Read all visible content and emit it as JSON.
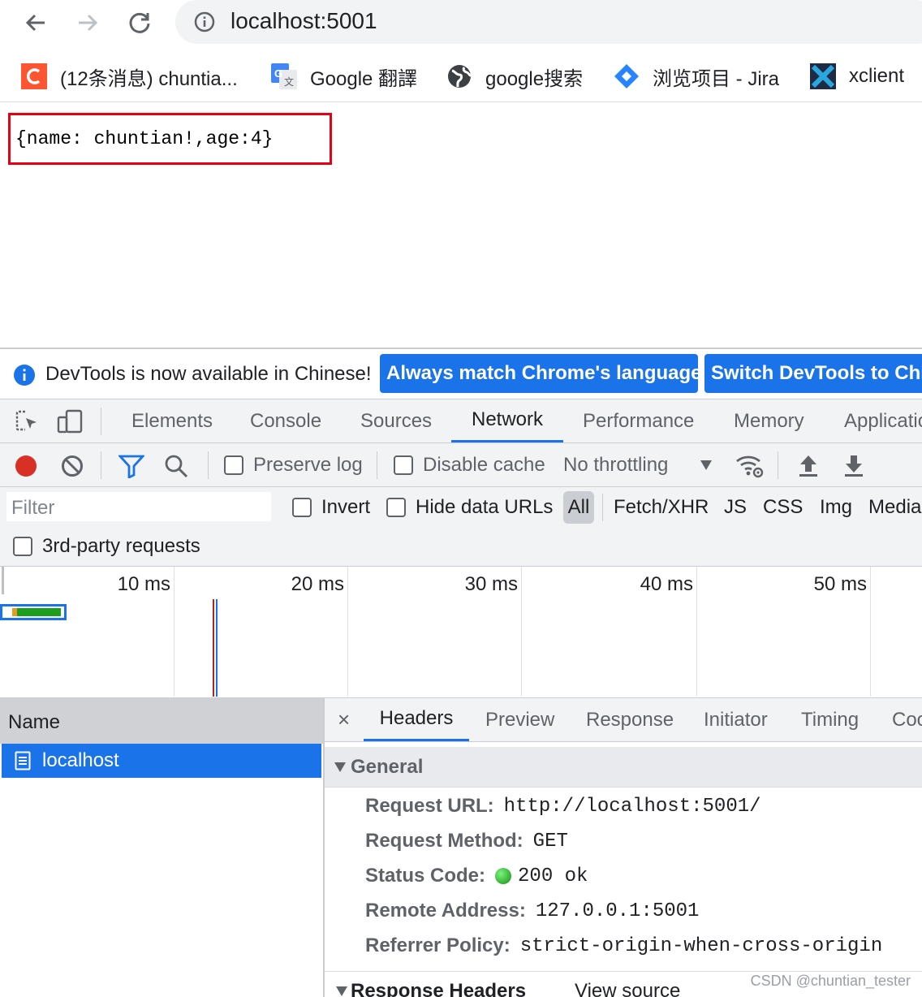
{
  "browser": {
    "url": "localhost:5001",
    "bookmarks": [
      {
        "label": "(12条消息) chuntia...",
        "icon": "csdn-icon"
      },
      {
        "label": "Google 翻譯",
        "icon": "google-translate-icon"
      },
      {
        "label": "google搜索",
        "icon": "globe-icon"
      },
      {
        "label": "浏览项目 - Jira",
        "icon": "jira-icon"
      },
      {
        "label": "xclient",
        "icon": "xclient-icon"
      }
    ]
  },
  "page": {
    "json_text": "{name: chuntian!,age:4}"
  },
  "devtools": {
    "infobar": {
      "message": "DevTools is now available in Chinese!",
      "btn_match": "Always match Chrome's language",
      "btn_switch": "Switch DevTools to Chi"
    },
    "tabs": [
      "Elements",
      "Console",
      "Sources",
      "Network",
      "Performance",
      "Memory",
      "Applicatio"
    ],
    "active_tab": "Network",
    "toolbar": {
      "preserve_log": "Preserve log",
      "disable_cache": "Disable cache",
      "throttling": "No throttling"
    },
    "filter": {
      "placeholder": "Filter",
      "invert": "Invert",
      "hide_data_urls": "Hide data URLs",
      "types": [
        "All",
        "Fetch/XHR",
        "JS",
        "CSS",
        "Img",
        "Media"
      ],
      "third_party": "3rd-party requests"
    },
    "timeline": {
      "ticks": [
        "10 ms",
        "20 ms",
        "30 ms",
        "40 ms",
        "50 ms"
      ]
    },
    "requests": {
      "header": "Name",
      "rows": [
        "localhost"
      ]
    },
    "detail": {
      "close": "×",
      "tabs": [
        "Headers",
        "Preview",
        "Response",
        "Initiator",
        "Timing",
        "Coo"
      ],
      "active_tab": "Headers",
      "general_title": "General",
      "general": [
        {
          "key": "Request URL:",
          "value": "http://localhost:5001/"
        },
        {
          "key": "Request Method:",
          "value": "GET"
        },
        {
          "key": "Status Code:",
          "value": "200 ok"
        },
        {
          "key": "Remote Address:",
          "value": "127.0.0.1:5001"
        },
        {
          "key": "Referrer Policy:",
          "value": "strict-origin-when-cross-origin"
        }
      ],
      "response_headers_title": "Response Headers",
      "view_source": "View source"
    }
  },
  "watermark": "CSDN @chuntian_tester",
  "colors": {
    "accent": "#1a73e8",
    "record": "#d93025",
    "highlight_box": "#e60012",
    "status_ok": "#1e9e1e"
  }
}
